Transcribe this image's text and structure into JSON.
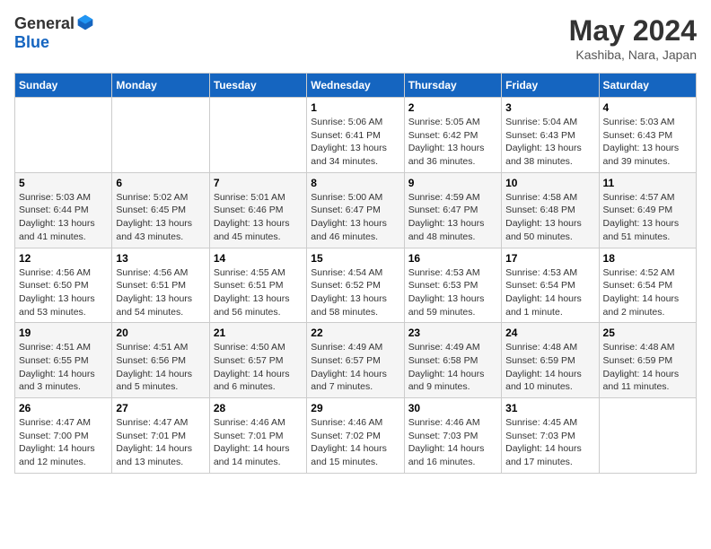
{
  "header": {
    "logo_general": "General",
    "logo_blue": "Blue",
    "month": "May 2024",
    "location": "Kashiba, Nara, Japan"
  },
  "days_of_week": [
    "Sunday",
    "Monday",
    "Tuesday",
    "Wednesday",
    "Thursday",
    "Friday",
    "Saturday"
  ],
  "weeks": [
    [
      {
        "day": "",
        "info": ""
      },
      {
        "day": "",
        "info": ""
      },
      {
        "day": "",
        "info": ""
      },
      {
        "day": "1",
        "info": "Sunrise: 5:06 AM\nSunset: 6:41 PM\nDaylight: 13 hours\nand 34 minutes."
      },
      {
        "day": "2",
        "info": "Sunrise: 5:05 AM\nSunset: 6:42 PM\nDaylight: 13 hours\nand 36 minutes."
      },
      {
        "day": "3",
        "info": "Sunrise: 5:04 AM\nSunset: 6:43 PM\nDaylight: 13 hours\nand 38 minutes."
      },
      {
        "day": "4",
        "info": "Sunrise: 5:03 AM\nSunset: 6:43 PM\nDaylight: 13 hours\nand 39 minutes."
      }
    ],
    [
      {
        "day": "5",
        "info": "Sunrise: 5:03 AM\nSunset: 6:44 PM\nDaylight: 13 hours\nand 41 minutes."
      },
      {
        "day": "6",
        "info": "Sunrise: 5:02 AM\nSunset: 6:45 PM\nDaylight: 13 hours\nand 43 minutes."
      },
      {
        "day": "7",
        "info": "Sunrise: 5:01 AM\nSunset: 6:46 PM\nDaylight: 13 hours\nand 45 minutes."
      },
      {
        "day": "8",
        "info": "Sunrise: 5:00 AM\nSunset: 6:47 PM\nDaylight: 13 hours\nand 46 minutes."
      },
      {
        "day": "9",
        "info": "Sunrise: 4:59 AM\nSunset: 6:47 PM\nDaylight: 13 hours\nand 48 minutes."
      },
      {
        "day": "10",
        "info": "Sunrise: 4:58 AM\nSunset: 6:48 PM\nDaylight: 13 hours\nand 50 minutes."
      },
      {
        "day": "11",
        "info": "Sunrise: 4:57 AM\nSunset: 6:49 PM\nDaylight: 13 hours\nand 51 minutes."
      }
    ],
    [
      {
        "day": "12",
        "info": "Sunrise: 4:56 AM\nSunset: 6:50 PM\nDaylight: 13 hours\nand 53 minutes."
      },
      {
        "day": "13",
        "info": "Sunrise: 4:56 AM\nSunset: 6:51 PM\nDaylight: 13 hours\nand 54 minutes."
      },
      {
        "day": "14",
        "info": "Sunrise: 4:55 AM\nSunset: 6:51 PM\nDaylight: 13 hours\nand 56 minutes."
      },
      {
        "day": "15",
        "info": "Sunrise: 4:54 AM\nSunset: 6:52 PM\nDaylight: 13 hours\nand 58 minutes."
      },
      {
        "day": "16",
        "info": "Sunrise: 4:53 AM\nSunset: 6:53 PM\nDaylight: 13 hours\nand 59 minutes."
      },
      {
        "day": "17",
        "info": "Sunrise: 4:53 AM\nSunset: 6:54 PM\nDaylight: 14 hours\nand 1 minute."
      },
      {
        "day": "18",
        "info": "Sunrise: 4:52 AM\nSunset: 6:54 PM\nDaylight: 14 hours\nand 2 minutes."
      }
    ],
    [
      {
        "day": "19",
        "info": "Sunrise: 4:51 AM\nSunset: 6:55 PM\nDaylight: 14 hours\nand 3 minutes."
      },
      {
        "day": "20",
        "info": "Sunrise: 4:51 AM\nSunset: 6:56 PM\nDaylight: 14 hours\nand 5 minutes."
      },
      {
        "day": "21",
        "info": "Sunrise: 4:50 AM\nSunset: 6:57 PM\nDaylight: 14 hours\nand 6 minutes."
      },
      {
        "day": "22",
        "info": "Sunrise: 4:49 AM\nSunset: 6:57 PM\nDaylight: 14 hours\nand 7 minutes."
      },
      {
        "day": "23",
        "info": "Sunrise: 4:49 AM\nSunset: 6:58 PM\nDaylight: 14 hours\nand 9 minutes."
      },
      {
        "day": "24",
        "info": "Sunrise: 4:48 AM\nSunset: 6:59 PM\nDaylight: 14 hours\nand 10 minutes."
      },
      {
        "day": "25",
        "info": "Sunrise: 4:48 AM\nSunset: 6:59 PM\nDaylight: 14 hours\nand 11 minutes."
      }
    ],
    [
      {
        "day": "26",
        "info": "Sunrise: 4:47 AM\nSunset: 7:00 PM\nDaylight: 14 hours\nand 12 minutes."
      },
      {
        "day": "27",
        "info": "Sunrise: 4:47 AM\nSunset: 7:01 PM\nDaylight: 14 hours\nand 13 minutes."
      },
      {
        "day": "28",
        "info": "Sunrise: 4:46 AM\nSunset: 7:01 PM\nDaylight: 14 hours\nand 14 minutes."
      },
      {
        "day": "29",
        "info": "Sunrise: 4:46 AM\nSunset: 7:02 PM\nDaylight: 14 hours\nand 15 minutes."
      },
      {
        "day": "30",
        "info": "Sunrise: 4:46 AM\nSunset: 7:03 PM\nDaylight: 14 hours\nand 16 minutes."
      },
      {
        "day": "31",
        "info": "Sunrise: 4:45 AM\nSunset: 7:03 PM\nDaylight: 14 hours\nand 17 minutes."
      },
      {
        "day": "",
        "info": ""
      }
    ]
  ]
}
